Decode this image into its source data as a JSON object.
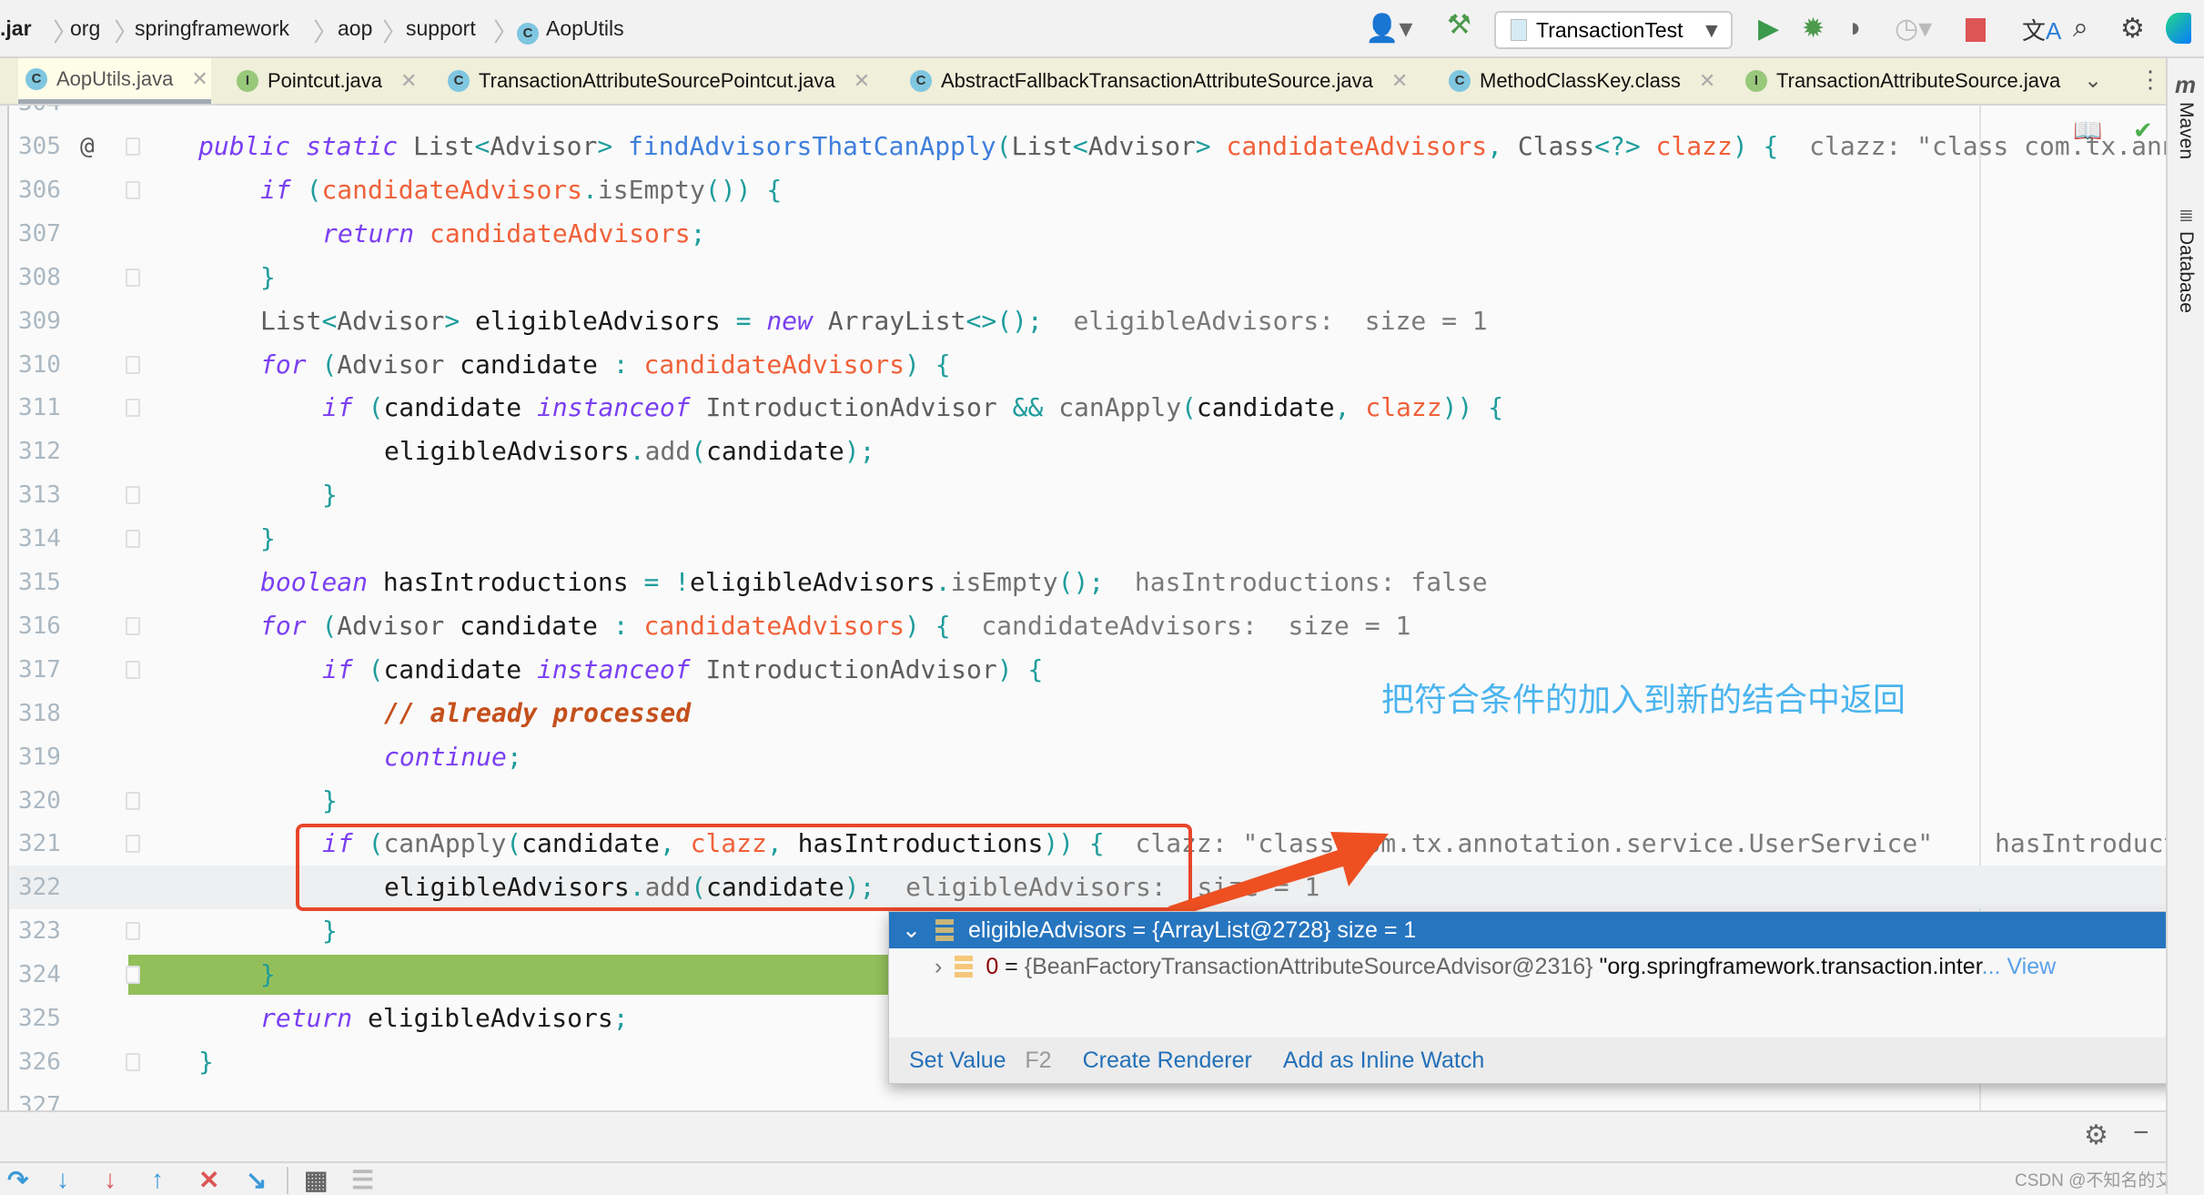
{
  "breadcrumb": [
    ".jar",
    "org",
    "springframework",
    "aop",
    "support",
    "AopUtils"
  ],
  "toolbar": {
    "run_config": "TransactionTest",
    "icons": [
      "user-icon",
      "hammer-build-icon",
      "run-icon",
      "debug-icon",
      "coverage-icon",
      "profile-icon",
      "stop-icon",
      "translate-icon",
      "search-icon",
      "gear-icon",
      "jetbrains-logo-icon"
    ]
  },
  "tabs": [
    {
      "label": "AopUtils.java",
      "kind": "C",
      "active": true
    },
    {
      "label": "Pointcut.java",
      "kind": "I"
    },
    {
      "label": "TransactionAttributeSourcePointcut.java",
      "kind": "C"
    },
    {
      "label": "AbstractFallbackTransactionAttributeSource.java",
      "kind": "C"
    },
    {
      "label": "MethodClassKey.class",
      "kind": "C"
    },
    {
      "label": "TransactionAttributeSource.java",
      "kind": "I"
    }
  ],
  "right_sidebar": [
    "Maven",
    "Database"
  ],
  "code": {
    "partial_line": "304",
    "lines": [
      {
        "n": "305",
        "i": 1,
        "t": [
          [
            "kw",
            "public static "
          ],
          [
            "type",
            "List"
          ],
          [
            "p",
            "<"
          ],
          [
            "type",
            "Advisor"
          ],
          [
            "p",
            "> "
          ],
          [
            "decl",
            "findAdvisorsThatCanApply"
          ],
          [
            "p",
            "("
          ],
          [
            "type",
            "List"
          ],
          [
            "p",
            "<"
          ],
          [
            "type",
            "Advisor"
          ],
          [
            "p",
            "> "
          ],
          [
            "param",
            "candidateAdvisors"
          ],
          [
            "p",
            ", "
          ],
          [
            "type",
            "Class"
          ],
          [
            "p",
            "<?> "
          ],
          [
            "param",
            "clazz"
          ],
          [
            "p",
            ") {"
          ]
        ],
        "h": "clazz: \"class com.tx.annotation.service.UserService\"",
        "at": true
      },
      {
        "n": "306",
        "i": 2,
        "t": [
          [
            "kw",
            "if "
          ],
          [
            "p",
            "("
          ],
          [
            "param",
            "candidateAdvisors"
          ],
          [
            "p",
            "."
          ],
          [
            "call",
            "isEmpty"
          ],
          [
            "p",
            "()) {"
          ]
        ]
      },
      {
        "n": "307",
        "i": 3,
        "t": [
          [
            "kw",
            "return "
          ],
          [
            "param",
            "candidateAdvisors"
          ],
          [
            "p",
            ";"
          ]
        ]
      },
      {
        "n": "308",
        "i": 2,
        "t": [
          [
            "p",
            "}"
          ]
        ]
      },
      {
        "n": "309",
        "i": 2,
        "t": [
          [
            "type",
            "List"
          ],
          [
            "p",
            "<"
          ],
          [
            "type",
            "Advisor"
          ],
          [
            "p",
            "> "
          ],
          [
            "id",
            "eligibleAdvisors "
          ],
          [
            "p",
            "= "
          ],
          [
            "kw",
            "new "
          ],
          [
            "type",
            "ArrayList"
          ],
          [
            "p",
            "<>();"
          ]
        ],
        "h": "eligibleAdvisors:  size = 1"
      },
      {
        "n": "310",
        "i": 2,
        "t": [
          [
            "kw",
            "for "
          ],
          [
            "p",
            "("
          ],
          [
            "type",
            "Advisor "
          ],
          [
            "id",
            "candidate "
          ],
          [
            "p",
            ": "
          ],
          [
            "param",
            "candidateAdvisors"
          ],
          [
            "p",
            ") {"
          ]
        ]
      },
      {
        "n": "311",
        "i": 3,
        "t": [
          [
            "kw",
            "if "
          ],
          [
            "p",
            "("
          ],
          [
            "id",
            "candidate "
          ],
          [
            "kw",
            "instanceof "
          ],
          [
            "type",
            "IntroductionAdvisor "
          ],
          [
            "p",
            "&& "
          ],
          [
            "call",
            "canApply"
          ],
          [
            "p",
            "("
          ],
          [
            "id",
            "candidate"
          ],
          [
            "p",
            ", "
          ],
          [
            "param",
            "clazz"
          ],
          [
            "p",
            ")) {"
          ]
        ]
      },
      {
        "n": "312",
        "i": 4,
        "t": [
          [
            "id",
            "eligibleAdvisors"
          ],
          [
            "p",
            "."
          ],
          [
            "call",
            "add"
          ],
          [
            "p",
            "("
          ],
          [
            "id",
            "candidate"
          ],
          [
            "p",
            ");"
          ]
        ]
      },
      {
        "n": "313",
        "i": 3,
        "t": [
          [
            "p",
            "}"
          ]
        ]
      },
      {
        "n": "314",
        "i": 2,
        "t": [
          [
            "p",
            "}"
          ]
        ]
      },
      {
        "n": "315",
        "i": 2,
        "t": [
          [
            "kw",
            "boolean "
          ],
          [
            "id",
            "hasIntroductions "
          ],
          [
            "p",
            "= !"
          ],
          [
            "id",
            "eligibleAdvisors"
          ],
          [
            "p",
            "."
          ],
          [
            "call",
            "isEmpty"
          ],
          [
            "p",
            "();"
          ]
        ],
        "h": "hasIntroductions: false"
      },
      {
        "n": "316",
        "i": 2,
        "t": [
          [
            "kw",
            "for "
          ],
          [
            "p",
            "("
          ],
          [
            "type",
            "Advisor "
          ],
          [
            "id",
            "candidate "
          ],
          [
            "p",
            ": "
          ],
          [
            "param",
            "candidateAdvisors"
          ],
          [
            "p",
            ") {"
          ]
        ],
        "h": "candidateAdvisors:  size = 1"
      },
      {
        "n": "317",
        "i": 3,
        "t": [
          [
            "kw",
            "if "
          ],
          [
            "p",
            "("
          ],
          [
            "id",
            "candidate "
          ],
          [
            "kw",
            "instanceof "
          ],
          [
            "type",
            "IntroductionAdvisor"
          ],
          [
            "p",
            ") {"
          ]
        ]
      },
      {
        "n": "318",
        "i": 4,
        "t": [
          [
            "cm",
            "// already processed"
          ]
        ]
      },
      {
        "n": "319",
        "i": 4,
        "t": [
          [
            "kw",
            "continue"
          ],
          [
            "p",
            ";"
          ]
        ]
      },
      {
        "n": "320",
        "i": 3,
        "t": [
          [
            "p",
            "}"
          ]
        ]
      },
      {
        "n": "321",
        "i": 3,
        "t": [
          [
            "kw",
            "if "
          ],
          [
            "p",
            "("
          ],
          [
            "call",
            "canApply"
          ],
          [
            "p",
            "("
          ],
          [
            "id",
            "candidate"
          ],
          [
            "p",
            ", "
          ],
          [
            "param",
            "clazz"
          ],
          [
            "p",
            ", "
          ],
          [
            "id",
            "hasIntroductions"
          ],
          [
            "p",
            ")) {"
          ]
        ],
        "h": "clazz: \"class com.tx.annotation.service.UserService\"",
        "h2": "hasIntroductions: false"
      },
      {
        "n": "322",
        "i": 4,
        "t": [
          [
            "id",
            "eligibleAdvisors"
          ],
          [
            "p",
            "."
          ],
          [
            "call",
            "add"
          ],
          [
            "p",
            "("
          ],
          [
            "id",
            "candidate"
          ],
          [
            "p",
            ");"
          ]
        ],
        "h": "eligibleAdvisors:  size = 1",
        "current": true
      },
      {
        "n": "323",
        "i": 3,
        "t": [
          [
            "p",
            "}"
          ]
        ]
      },
      {
        "n": "324",
        "i": 2,
        "t": [
          [
            "p",
            "}"
          ]
        ],
        "exec": true
      },
      {
        "n": "325",
        "i": 2,
        "t": [
          [
            "kw",
            "return "
          ],
          [
            "id",
            "eligibleAdvisors"
          ],
          [
            "p",
            ";"
          ]
        ]
      },
      {
        "n": "326",
        "i": 1,
        "t": [
          [
            "p",
            "}"
          ]
        ]
      },
      {
        "n": "327",
        "i": 0,
        "t": []
      }
    ]
  },
  "annotation": {
    "text": "把符合条件的加入到新的结合中返回",
    "color": "#4ab4ee",
    "arrow_color": "#ee5022",
    "box_color": "#e8462a"
  },
  "popup": {
    "header": "eligibleAdvisors = {ArrayList@2728}  size = 1",
    "child_index": "0",
    "child_eq": " = ",
    "child_value": "{BeanFactoryTransactionAttributeSourceAdvisor@2316}",
    "child_string": "\"org.springframework.transaction.inter",
    "view_link": "... View",
    "actions": {
      "set_value": "Set Value",
      "set_value_key": "F2",
      "create_renderer": "Create Renderer",
      "inline_watch": "Add as Inline Watch"
    }
  },
  "watermark": "CSDN @不知名的艾坤"
}
